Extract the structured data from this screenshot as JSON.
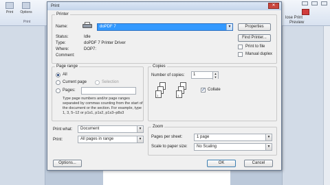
{
  "ribbon": {
    "print_label": "Print",
    "options_label": "Options",
    "group_label": "Print",
    "right_label_1": "lose Print",
    "right_label_2": "Preview"
  },
  "dialog": {
    "title": "Print",
    "close_glyph": "✕"
  },
  "printer": {
    "section": "Printer",
    "name_label": "Name:",
    "name_value": "doPDF 7",
    "status_label": "Status:",
    "status_value": "Idle",
    "type_label": "Type:",
    "type_value": "doPDF 7 Printer Driver",
    "where_label": "Where:",
    "where_value": "DOP7:",
    "comment_label": "Comment:",
    "comment_value": "",
    "properties_button": "Properties",
    "find_printer_button": "Find Printer...",
    "print_to_file_label": "Print to file",
    "print_to_file_checked": false,
    "manual_duplex_label": "Manual duplex",
    "manual_duplex_checked": false
  },
  "page_range": {
    "section": "Page range",
    "all_label": "All",
    "current_page_label": "Current page",
    "selection_label": "Selection",
    "pages_label": "Pages:",
    "pages_value": "",
    "selected": "all",
    "help_text": "Type page numbers and/or page ranges separated by commas counting from the start of the document or the section. For example, type 1, 3, 5–12 or p1s1, p1s2, p1s3–p8s3"
  },
  "copies": {
    "section": "Copies",
    "number_label": "Number of copies:",
    "number_value": "1",
    "collate_label": "Collate",
    "collate_checked": true
  },
  "print_what": {
    "label": "Print what:",
    "value": "Document"
  },
  "print": {
    "label": "Print:",
    "value": "All pages in range"
  },
  "zoom": {
    "section": "Zoom",
    "pages_per_sheet_label": "Pages per sheet:",
    "pages_per_sheet_value": "1 page",
    "scale_label": "Scale to paper size:",
    "scale_value": "No Scaling"
  },
  "footer": {
    "options_button": "Options...",
    "ok_button": "OK",
    "cancel_button": "Cancel"
  },
  "icons": {
    "dropdown_arrow": "▼",
    "spin_up": "▲",
    "spin_down": "▼"
  },
  "colors": {
    "selection_blue": "#3399ff",
    "title_bar": "#c4d4ea",
    "dialog_bg": "#f0f0f0"
  }
}
